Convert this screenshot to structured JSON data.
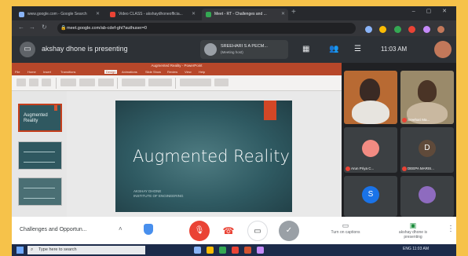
{
  "browser": {
    "tabs": [
      {
        "label": "www.google.com - Google Search",
        "active": false
      },
      {
        "label": "Video CLASS - akshaydhoneofficia...",
        "active": false
      },
      {
        "label": "Meet - RT - Challenges and ...",
        "active": true
      }
    ],
    "address": "meet.google.com/ab-cdef-ghi?authuser=0",
    "new_tab": "+",
    "window_controls": "–  ▢  ✕"
  },
  "meet_banner": {
    "presenting_text": "akshay dhone is presenting",
    "speaker_name": "SREEHARI S A PECM...",
    "speaker_sub": "(Meeting host)",
    "time": "11:03 AM"
  },
  "ppt": {
    "title": "Augmented Reality - PowerPoint",
    "menu": [
      "File",
      "Home",
      "Insert",
      "Design",
      "Transitions",
      "Animations",
      "Slide Show",
      "Review",
      "View",
      "Help"
    ],
    "active_menu": "Design",
    "thumb1_text": "Augmented Reality",
    "slide_title": "Augmented Reality",
    "slide_sub": "AKSHAY DHONE\nINSTITUTE OF ENGINEERING"
  },
  "participants": [
    {
      "name": "",
      "type": "video"
    },
    {
      "name": "Sreehari Ma...",
      "type": "video"
    },
    {
      "name": "Arun Priya C...",
      "initial": "",
      "color": "#f28b82"
    },
    {
      "name": "DEEPA MARIS...",
      "initial": "D",
      "color": "#5f4a3a"
    },
    {
      "name": "",
      "initial": "S",
      "color": "#1a73e8"
    },
    {
      "name": "",
      "initial": "",
      "color": "#8e6bbf"
    }
  ],
  "controls": {
    "meeting_info": "Challenges and Opportun...",
    "captions_label": "Turn on captions",
    "presenting_label": "akshay dhone is presenting"
  },
  "taskbar": {
    "search_placeholder": "Type here to search",
    "tray_text": "ENG  11:03 AM"
  },
  "colors": {
    "ppt_brand": "#b7472a",
    "slide_bg": "#2f5a62",
    "slide_accent": "#d44726",
    "mic_off": "#ea4335",
    "frame": "#f6c24a"
  }
}
